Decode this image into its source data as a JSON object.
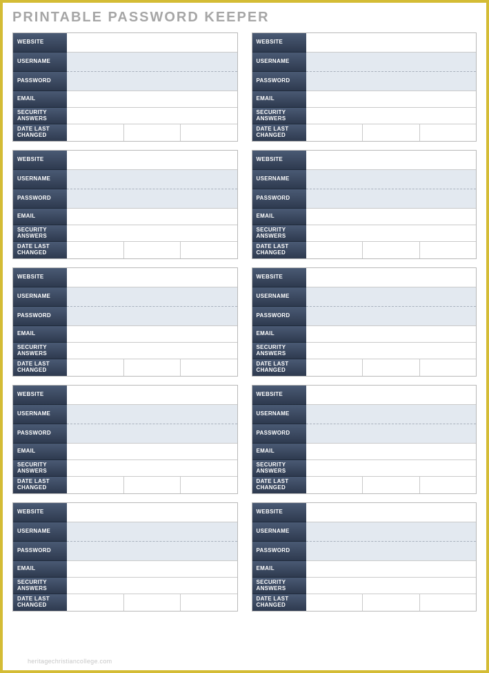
{
  "title": "PRINTABLE PASSWORD KEEPER",
  "labels": {
    "website": "WEBSITE",
    "username": "USERNAME",
    "password": "PASSWORD",
    "email": "EMAIL",
    "security": "SECURITY ANSWERS",
    "date": "DATE LAST CHANGED"
  },
  "watermark": "heritagechristiancollege.com",
  "card_count": 10
}
